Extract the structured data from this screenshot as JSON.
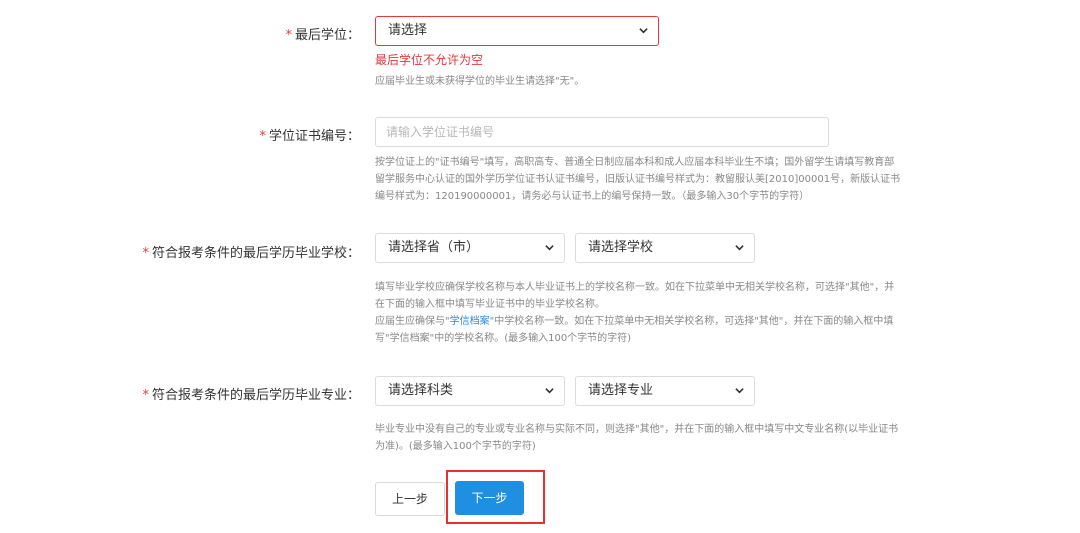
{
  "degree": {
    "label": "最后学位：",
    "required_mark": "*",
    "select_value": "请选择",
    "error": "最后学位不允许为空",
    "hint": "应届毕业生或未获得学位的毕业生请选择\"无\"。"
  },
  "certificate": {
    "label": "学位证书编号：",
    "required_mark": "*",
    "placeholder": "请输入学位证书编号",
    "hint_line1": "按学位证上的\"证书编号\"填写，高职高专、普通全日制应届本科和成人应届本科毕业生不填；国外留学生请填写教育部",
    "hint_line2": "留学服务中心认证的国外学历学位证书认证书编号，旧版认证书编号样式为：教留服认美[2010]00001号，新版认证书",
    "hint_line3": "编号样式为：120190000001，请务必与认证书上的编号保持一致。（最多输入30个字节的字符）"
  },
  "school": {
    "label": "符合报考条件的最后学历毕业学校：",
    "required_mark": "*",
    "province_select": "请选择省（市）",
    "school_select": "请选择学校",
    "hint_line1": "填写毕业学校应确保学校名称与本人毕业证书上的学校名称一致。如在下拉菜单中无相关学校名称，可选择\"其他\"，并",
    "hint_line2": "在下面的输入框中填写毕业证书中的毕业学校名称。",
    "hint_line3_pre": "应届生应确保与\"",
    "hint_line3_link": "学信档案",
    "hint_line3_post": "\"中学校名称一致。如在下拉菜单中无相关学校名称，可选择\"其他\"，并在下面的输入框中填",
    "hint_line4": "写\"学信档案\"中的学校名称。(最多输入100个字节的字符)"
  },
  "major": {
    "label": "符合报考条件的最后学历毕业专业：",
    "required_mark": "*",
    "category_select": "请选择科类",
    "major_select": "请选择专业",
    "hint_line1": "毕业专业中没有自己的专业或专业名称与实际不同，则选择\"其他\"，并在下面的输入框中填写中文专业名称(以毕业证书",
    "hint_line2": "为准)。(最多输入100个字节的字符)"
  },
  "buttons": {
    "prev": "上一步",
    "next": "下一步"
  },
  "colors": {
    "required": "#e4393c",
    "primary_button": "#1e8fe1",
    "highlight_box": "#e8312e",
    "link": "#2b8cd9"
  }
}
